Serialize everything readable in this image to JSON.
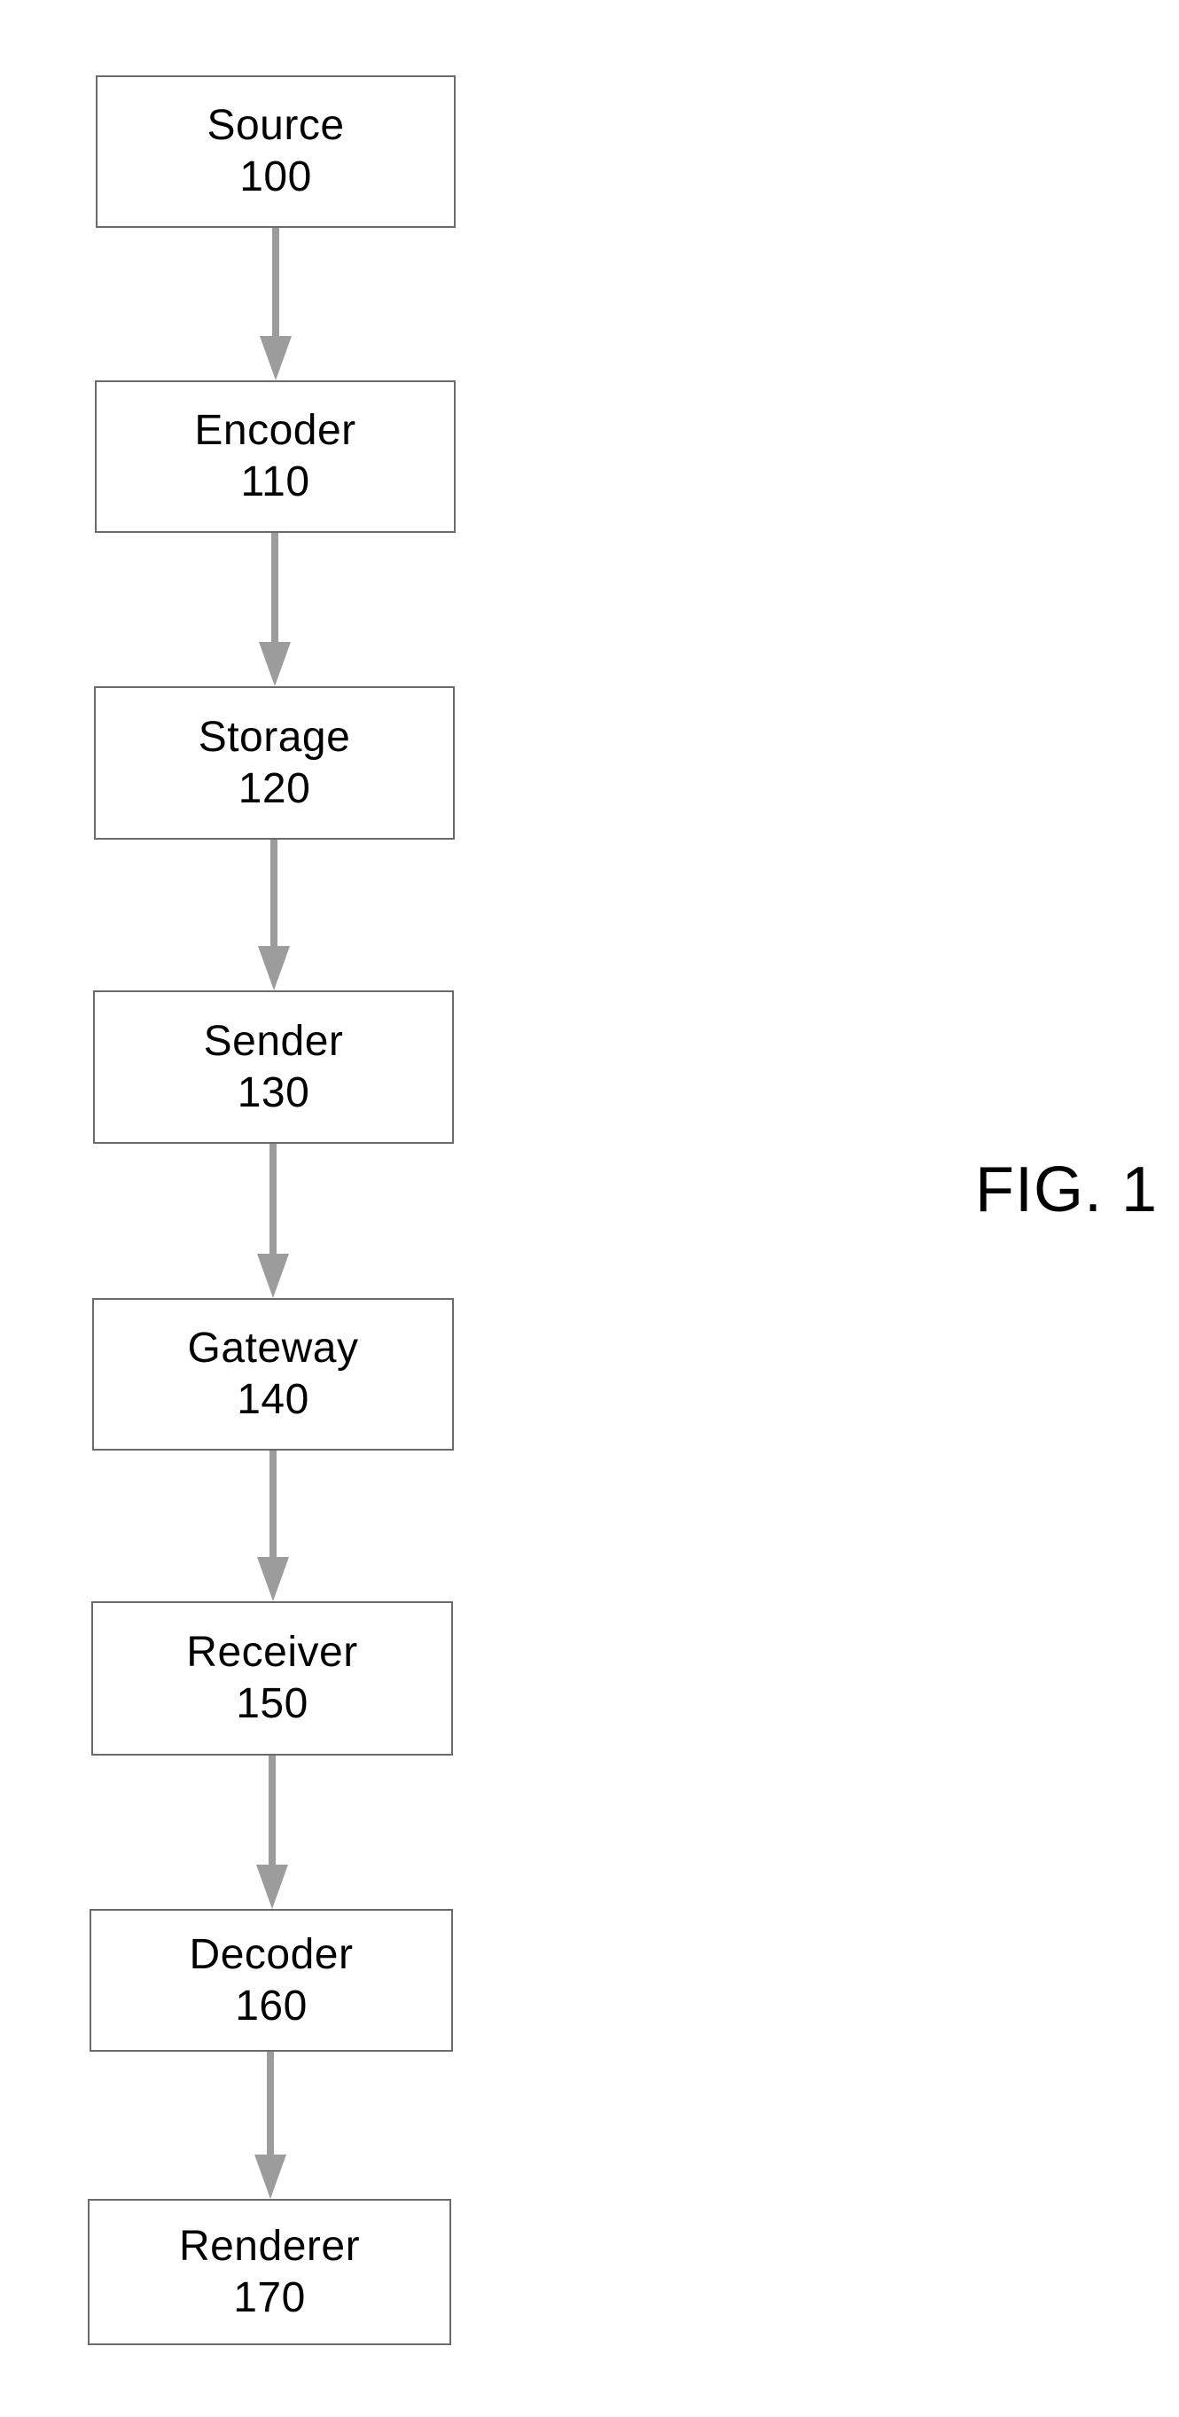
{
  "figure": {
    "label": "FIG. 1",
    "arrow_color": "#9c9c9c",
    "border_color": "#6a6a6a"
  },
  "nodes": [
    {
      "name": "Source",
      "ref": "100"
    },
    {
      "name": "Encoder",
      "ref": "110"
    },
    {
      "name": "Storage",
      "ref": "120"
    },
    {
      "name": "Sender",
      "ref": "130"
    },
    {
      "name": "Gateway",
      "ref": "140"
    },
    {
      "name": "Receiver",
      "ref": "150"
    },
    {
      "name": "Decoder",
      "ref": "160"
    },
    {
      "name": "Renderer",
      "ref": "170"
    }
  ],
  "edges": [
    {
      "from": "100",
      "to": "110"
    },
    {
      "from": "110",
      "to": "120"
    },
    {
      "from": "120",
      "to": "130"
    },
    {
      "from": "130",
      "to": "140"
    },
    {
      "from": "140",
      "to": "150"
    },
    {
      "from": "150",
      "to": "160"
    },
    {
      "from": "160",
      "to": "170"
    }
  ]
}
